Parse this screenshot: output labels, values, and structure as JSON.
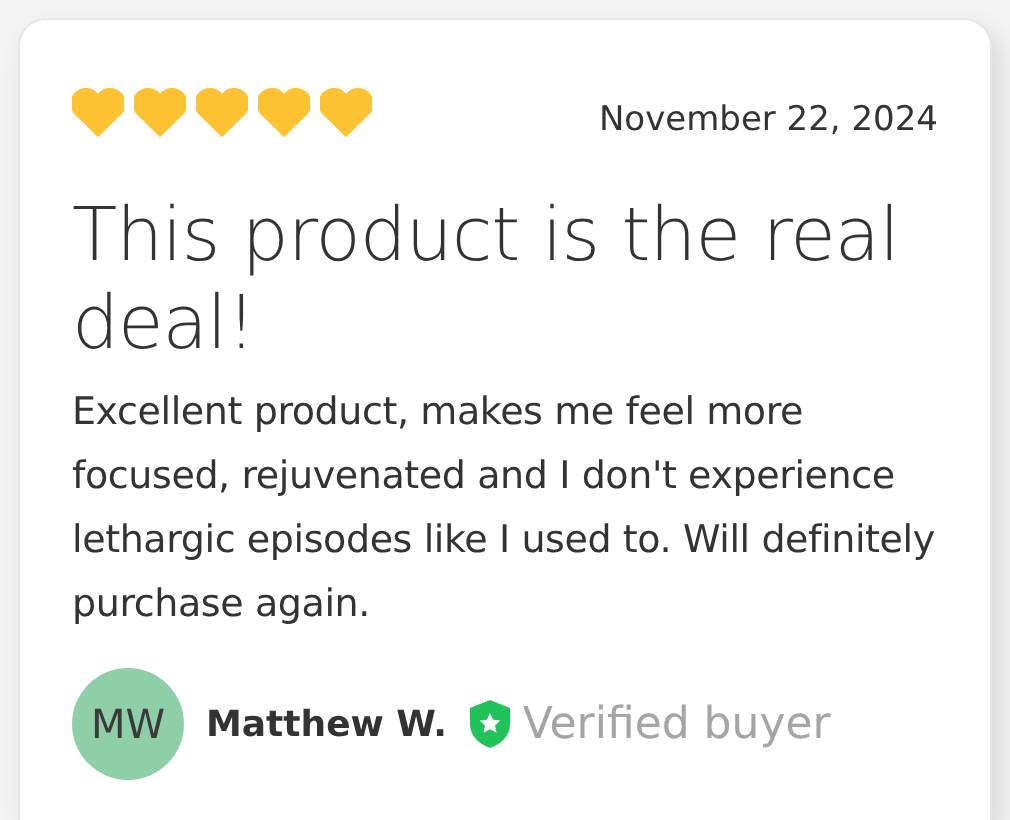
{
  "review": {
    "stars": 5,
    "date": "November 22, 2024",
    "title": "This product is the real deal!",
    "body": "Excellent product, makes me feel more focused, rejuvenated and I don't experience lethargic episodes like I used to. Will definitely purchase again.",
    "author": {
      "initials": "MW",
      "name": "Matthew W.",
      "verified": true,
      "badge": "Verified buyer"
    }
  }
}
